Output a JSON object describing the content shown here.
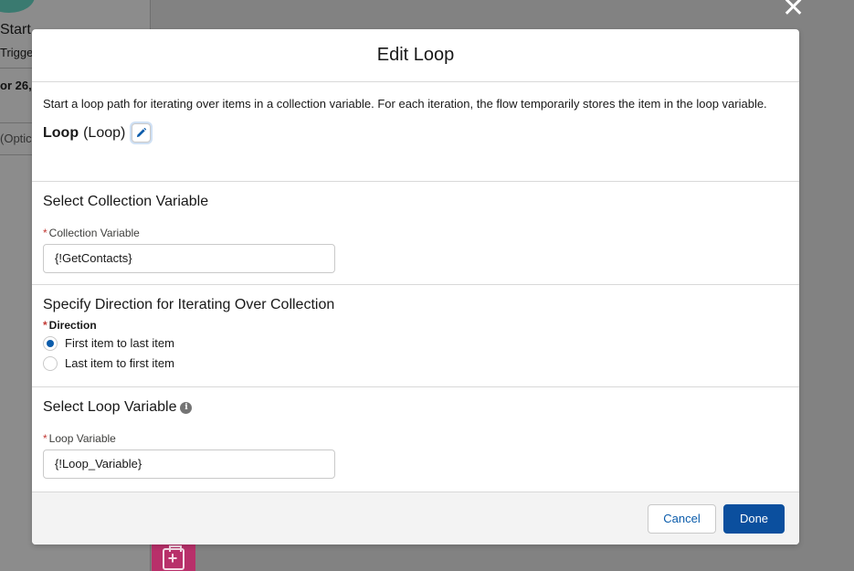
{
  "background": {
    "start_label": "Start",
    "trigger_label": "Trigge",
    "date_label": "or 26,",
    "optional_label": "(Optic"
  },
  "modal": {
    "title": "Edit Loop",
    "description": "Start a loop path for iterating over items in a collection variable. For each iteration, the flow temporarily stores the item in the loop variable.",
    "element_name": "Loop",
    "element_type": "(Loop)",
    "collection_section": {
      "title": "Select Collection Variable",
      "field_label": "Collection Variable",
      "required_mark": "*",
      "value": "{!GetContacts}"
    },
    "direction_section": {
      "title": "Specify Direction for Iterating Over Collection",
      "field_label": "Direction",
      "required_mark": "*",
      "options": [
        "First item to last item",
        "Last item to first item"
      ],
      "selected": "First item to last item"
    },
    "loopvar_section": {
      "title": "Select Loop Variable",
      "info_icon": "info-icon",
      "field_label": "Loop Variable",
      "required_mark": "*",
      "value": "{!Loop_Variable}"
    },
    "footer": {
      "cancel_label": "Cancel",
      "done_label": "Done"
    }
  },
  "colors": {
    "brand": "#0b4f9e",
    "required": "#c23934",
    "loop_node": "#b8306a"
  }
}
